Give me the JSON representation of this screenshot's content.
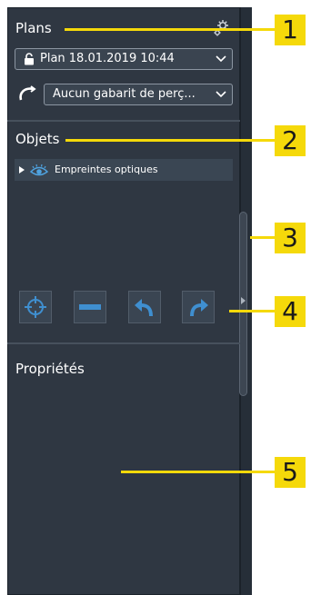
{
  "plans": {
    "title": "Plans",
    "plan_dropdown": "Plan 18.01.2019 10:44",
    "template_dropdown": "Aucun gabarit de perç..."
  },
  "objects": {
    "title": "Objets",
    "tree_item": "Empreintes optiques"
  },
  "properties": {
    "title": "Propriétés"
  },
  "callouts": [
    "1",
    "2",
    "3",
    "4",
    "5"
  ],
  "icons": {
    "settings": "gear-icon",
    "lock": "lock-icon",
    "template": "drill-template-icon",
    "visibility": "eye-icon",
    "expand": "triangle-right-icon",
    "center": "crosshair-icon",
    "remove": "minus-icon",
    "undo": "undo-icon",
    "redo": "redo-icon",
    "collapse": "panel-collapse-icon"
  },
  "colors": {
    "panel": "#2f3742",
    "callout": "#f5d90a",
    "accent": "#4fa3e0"
  }
}
